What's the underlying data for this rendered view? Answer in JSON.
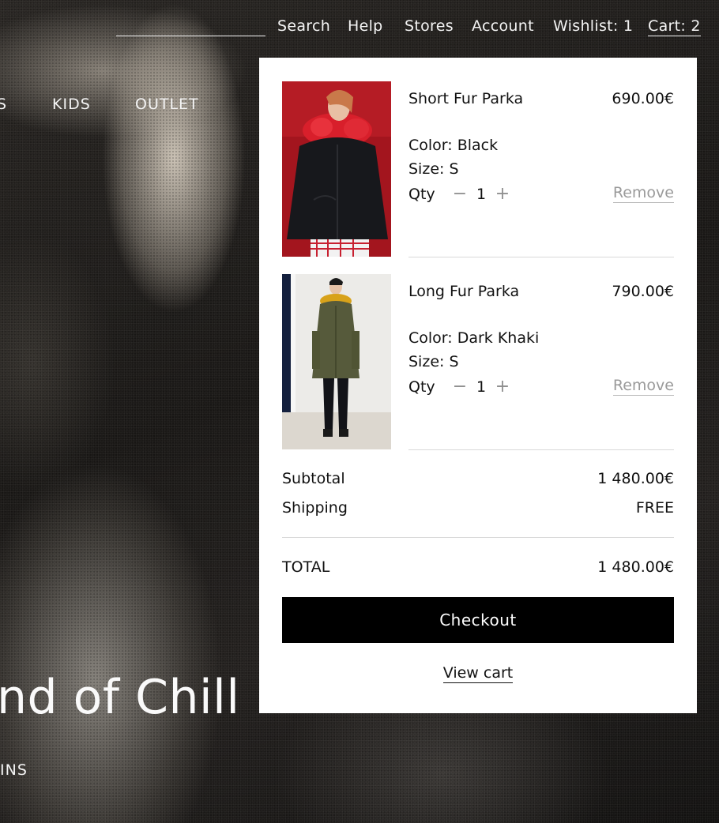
{
  "header": {
    "nav": {
      "search": "Search",
      "help": "Help",
      "stores": "Stores",
      "account": "Account",
      "wishlist": "Wishlist: 1",
      "cart": "Cart: 2"
    },
    "categories": [
      "S",
      "KIDS",
      "OUTLET"
    ]
  },
  "hero": {
    "title": "nd of Chill",
    "subtitle": "INS"
  },
  "cart": {
    "items": [
      {
        "name": "Short Fur Parka",
        "price": "690.00€",
        "color": "Color: Black",
        "size": "Size: S",
        "qty_label": "Qty",
        "qty": "1",
        "remove_label": "Remove"
      },
      {
        "name": "Long Fur Parka",
        "price": "790.00€",
        "color": "Color: Dark Khaki",
        "size": "Size: S",
        "qty_label": "Qty",
        "qty": "1",
        "remove_label": "Remove"
      }
    ],
    "summary": {
      "subtotal_label": "Subtotal",
      "subtotal_value": "1 480.00€",
      "shipping_label": "Shipping",
      "shipping_value": "FREE",
      "total_label": "TOTAL",
      "total_value": "1 480.00€"
    },
    "checkout_label": "Checkout",
    "view_cart_label": "View cart"
  },
  "colors": {
    "panel_bg": "#ffffff",
    "checkout_bg": "#000000",
    "muted_text": "#9a9a9a",
    "divider": "#d9d9d9"
  },
  "icons": {
    "qty_minus": "minus-icon",
    "qty_plus": "plus-icon"
  }
}
